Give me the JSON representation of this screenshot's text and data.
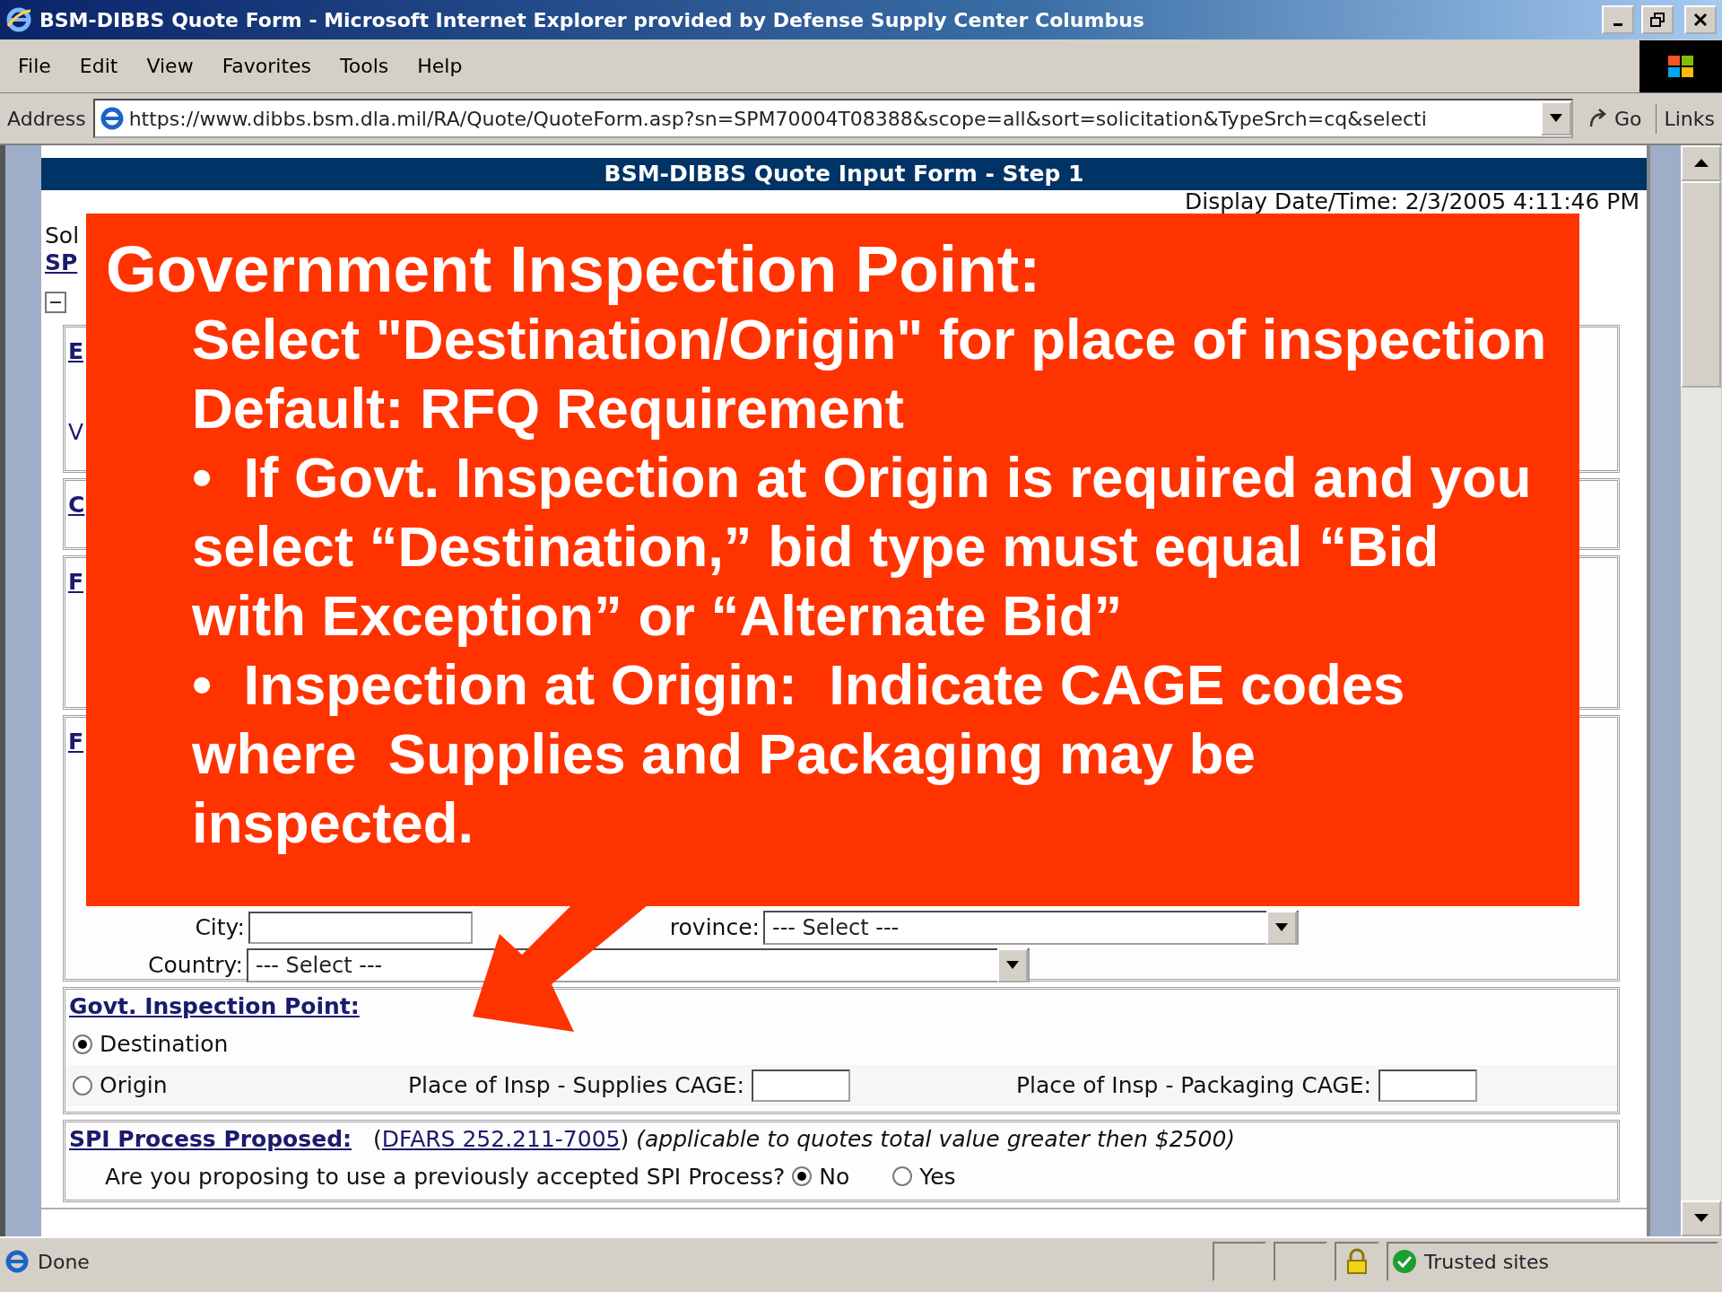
{
  "window": {
    "title": "BSM-DIBBS Quote Form - Microsoft Internet Explorer provided by Defense Supply Center Columbus"
  },
  "menu": [
    "File",
    "Edit",
    "View",
    "Favorites",
    "Tools",
    "Help"
  ],
  "address_bar": {
    "label": "Address",
    "url": "https://www.dibbs.bsm.dla.mil/RA/Quote/QuoteForm.asp?sn=SPM70004T08388&scope=all&sort=solicitation&TypeSrch=cq&selecti",
    "go": "Go",
    "links": "Links"
  },
  "form": {
    "heading": "BSM-DIBBS Quote Input Form - Step 1",
    "display_date": "Display Date/Time: 2/3/2005 4:11:46 PM",
    "solicitation_label": "Sol",
    "solicitation_link": "SP",
    "section_fragments": [
      "E",
      "V",
      "C",
      "F",
      "F"
    ],
    "city_label": "City:",
    "province_label": "rovince:",
    "province_select": "--- Select ---",
    "country_label": "Country:",
    "country_select": "--- Select ---",
    "inspection": {
      "title": "Govt. Inspection Point:",
      "options": [
        {
          "label": "Destination",
          "selected": true
        },
        {
          "label": "Origin",
          "selected": false
        }
      ],
      "supplies_cage_label": "Place of Insp - Supplies CAGE:",
      "packaging_cage_label": "Place of Insp - Packaging CAGE:"
    },
    "spi": {
      "title": "SPI Process Proposed:",
      "open_paren": "(",
      "reference": "DFARS 252.211-7005",
      "close_paren": ")",
      "note": "(applicable to quotes total value greater then $2500)",
      "question": "Are you proposing to use a previously accepted SPI Process?",
      "options": [
        {
          "label": "No",
          "selected": true
        },
        {
          "label": "Yes",
          "selected": false
        }
      ]
    }
  },
  "status_bar": {
    "text": "Done",
    "zone": "Trusted sites"
  },
  "callout": {
    "title": "Government Inspection Point:",
    "lines": [
      "Select \"Destination/Origin\" for place of inspection",
      "Default: RFQ Requirement",
      "•  If Govt. Inspection at Origin is required and you select “Destination,” bid type must equal “Bid with Exception” or “Alternate Bid”",
      "•  Inspection at Origin:  Indicate CAGE codes where  Supplies and Packaging may be inspected."
    ]
  }
}
